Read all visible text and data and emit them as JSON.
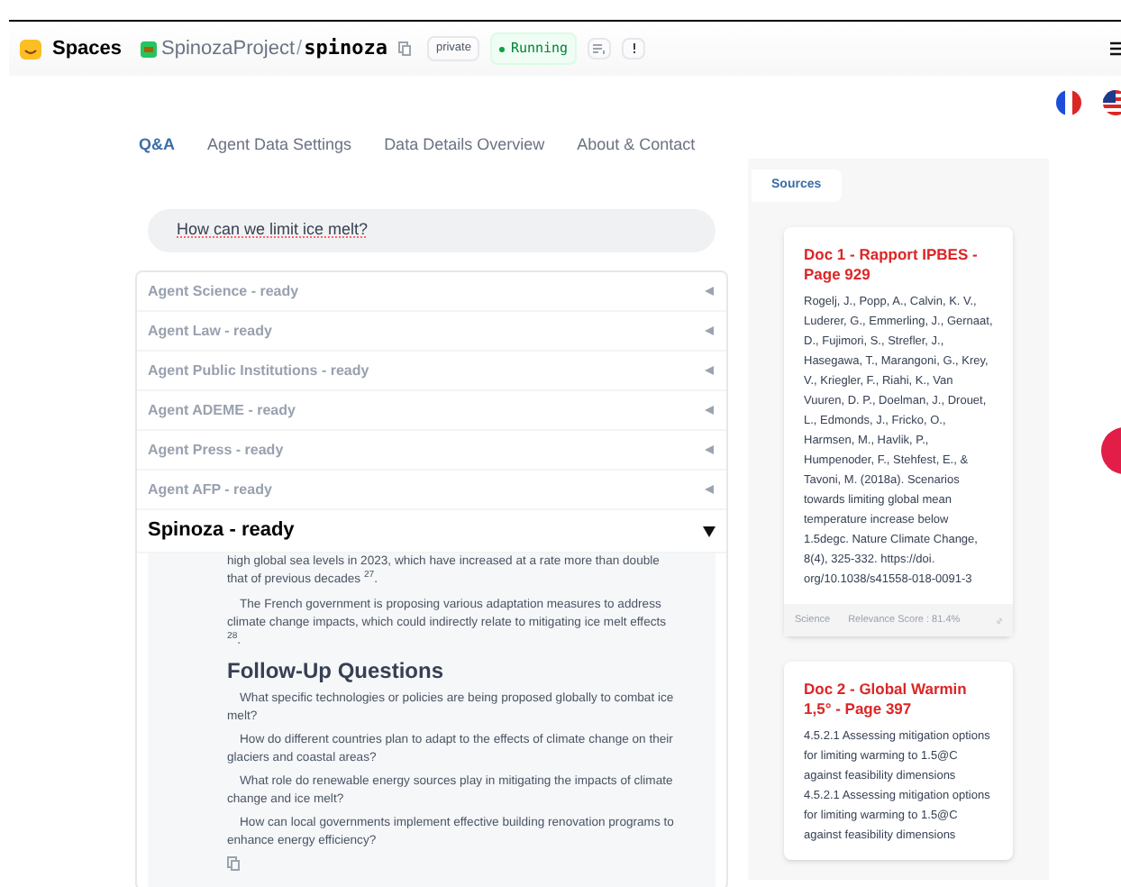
{
  "header": {
    "brand": "Spaces",
    "owner": "SpinozaProject",
    "separator": "/",
    "repo": "spinoza",
    "visibility": "private",
    "status": "Running"
  },
  "tabs": [
    {
      "label": "Q&A",
      "selected": true
    },
    {
      "label": "Agent Data Settings",
      "selected": false
    },
    {
      "label": "Data Details Overview",
      "selected": false
    },
    {
      "label": "About & Contact",
      "selected": false
    }
  ],
  "search": {
    "value": "How can we limit ice melt?"
  },
  "agents": [
    {
      "label": "Agent Science - ready",
      "expanded": false
    },
    {
      "label": "Agent Law - ready",
      "expanded": false
    },
    {
      "label": "Agent Public Institutions - ready",
      "expanded": false
    },
    {
      "label": "Agent ADEME - ready",
      "expanded": false
    },
    {
      "label": "Agent Press - ready",
      "expanded": false
    },
    {
      "label": "Agent AFP - ready",
      "expanded": false
    },
    {
      "label": "Spinoza - ready",
      "expanded": true
    }
  ],
  "answer": {
    "paragraphs": [
      "high global sea levels in 2023, which have increased at a rate more than double that of previous decades $^{27}$.",
      "The French government is proposing various adaptation measures to address climate change impacts, which could indirectly relate to mitigating ice melt effects $^{28}$."
    ],
    "follow_up_title": "Follow-Up Questions",
    "questions": [
      "What specific technologies or policies are being proposed globally to combat ice melt?",
      "How do different countries plan to adapt to the effects of climate change on their glaciers and coastal areas?",
      "What role do renewable energy sources play in mitigating the impacts of climate change and ice melt?",
      "How can local governments implement effective building renovation programs to enhance energy efficiency?"
    ]
  },
  "sources": {
    "tab": "Sources",
    "docs": [
      {
        "title": "Doc 1 - Rapport IPBES - Page 929",
        "text": "Rogelj, J., Popp, A., Calvin, K. V., Luderer, G., Emmerling, J., Gernaat, D., Fujimori, S., Strefler, J., Hasegawa, T., Marangoni, G., Krey, V., Kriegler, F., Riahi, K., Van Vuuren, D. P., Doelman, J., Drouet, L., Edmonds, J., Fricko, O., Harmsen, M., Havlik, P., Humpenoder, F., Stehfest, E., & Tavoni, M. (2018a). Scenarios towards limiting global mean temperature increase below 1.5degc. Nature Climate Change, 8(4), 325-332. https://doi. org/10.1038/s41558-018-0091-3",
        "category": "Science",
        "score": "Relevance Score : 81.4%"
      },
      {
        "title": "Doc 2 - Global Warmin 1,5° - Page 397",
        "text": "4.5.2.1 Assessing mitigation options for limiting warming to 1.5@C against feasibility dimensions 4.5.2.1 Assessing mitigation options for limiting warming to 1.5@C against feasibility dimensions"
      }
    ]
  }
}
